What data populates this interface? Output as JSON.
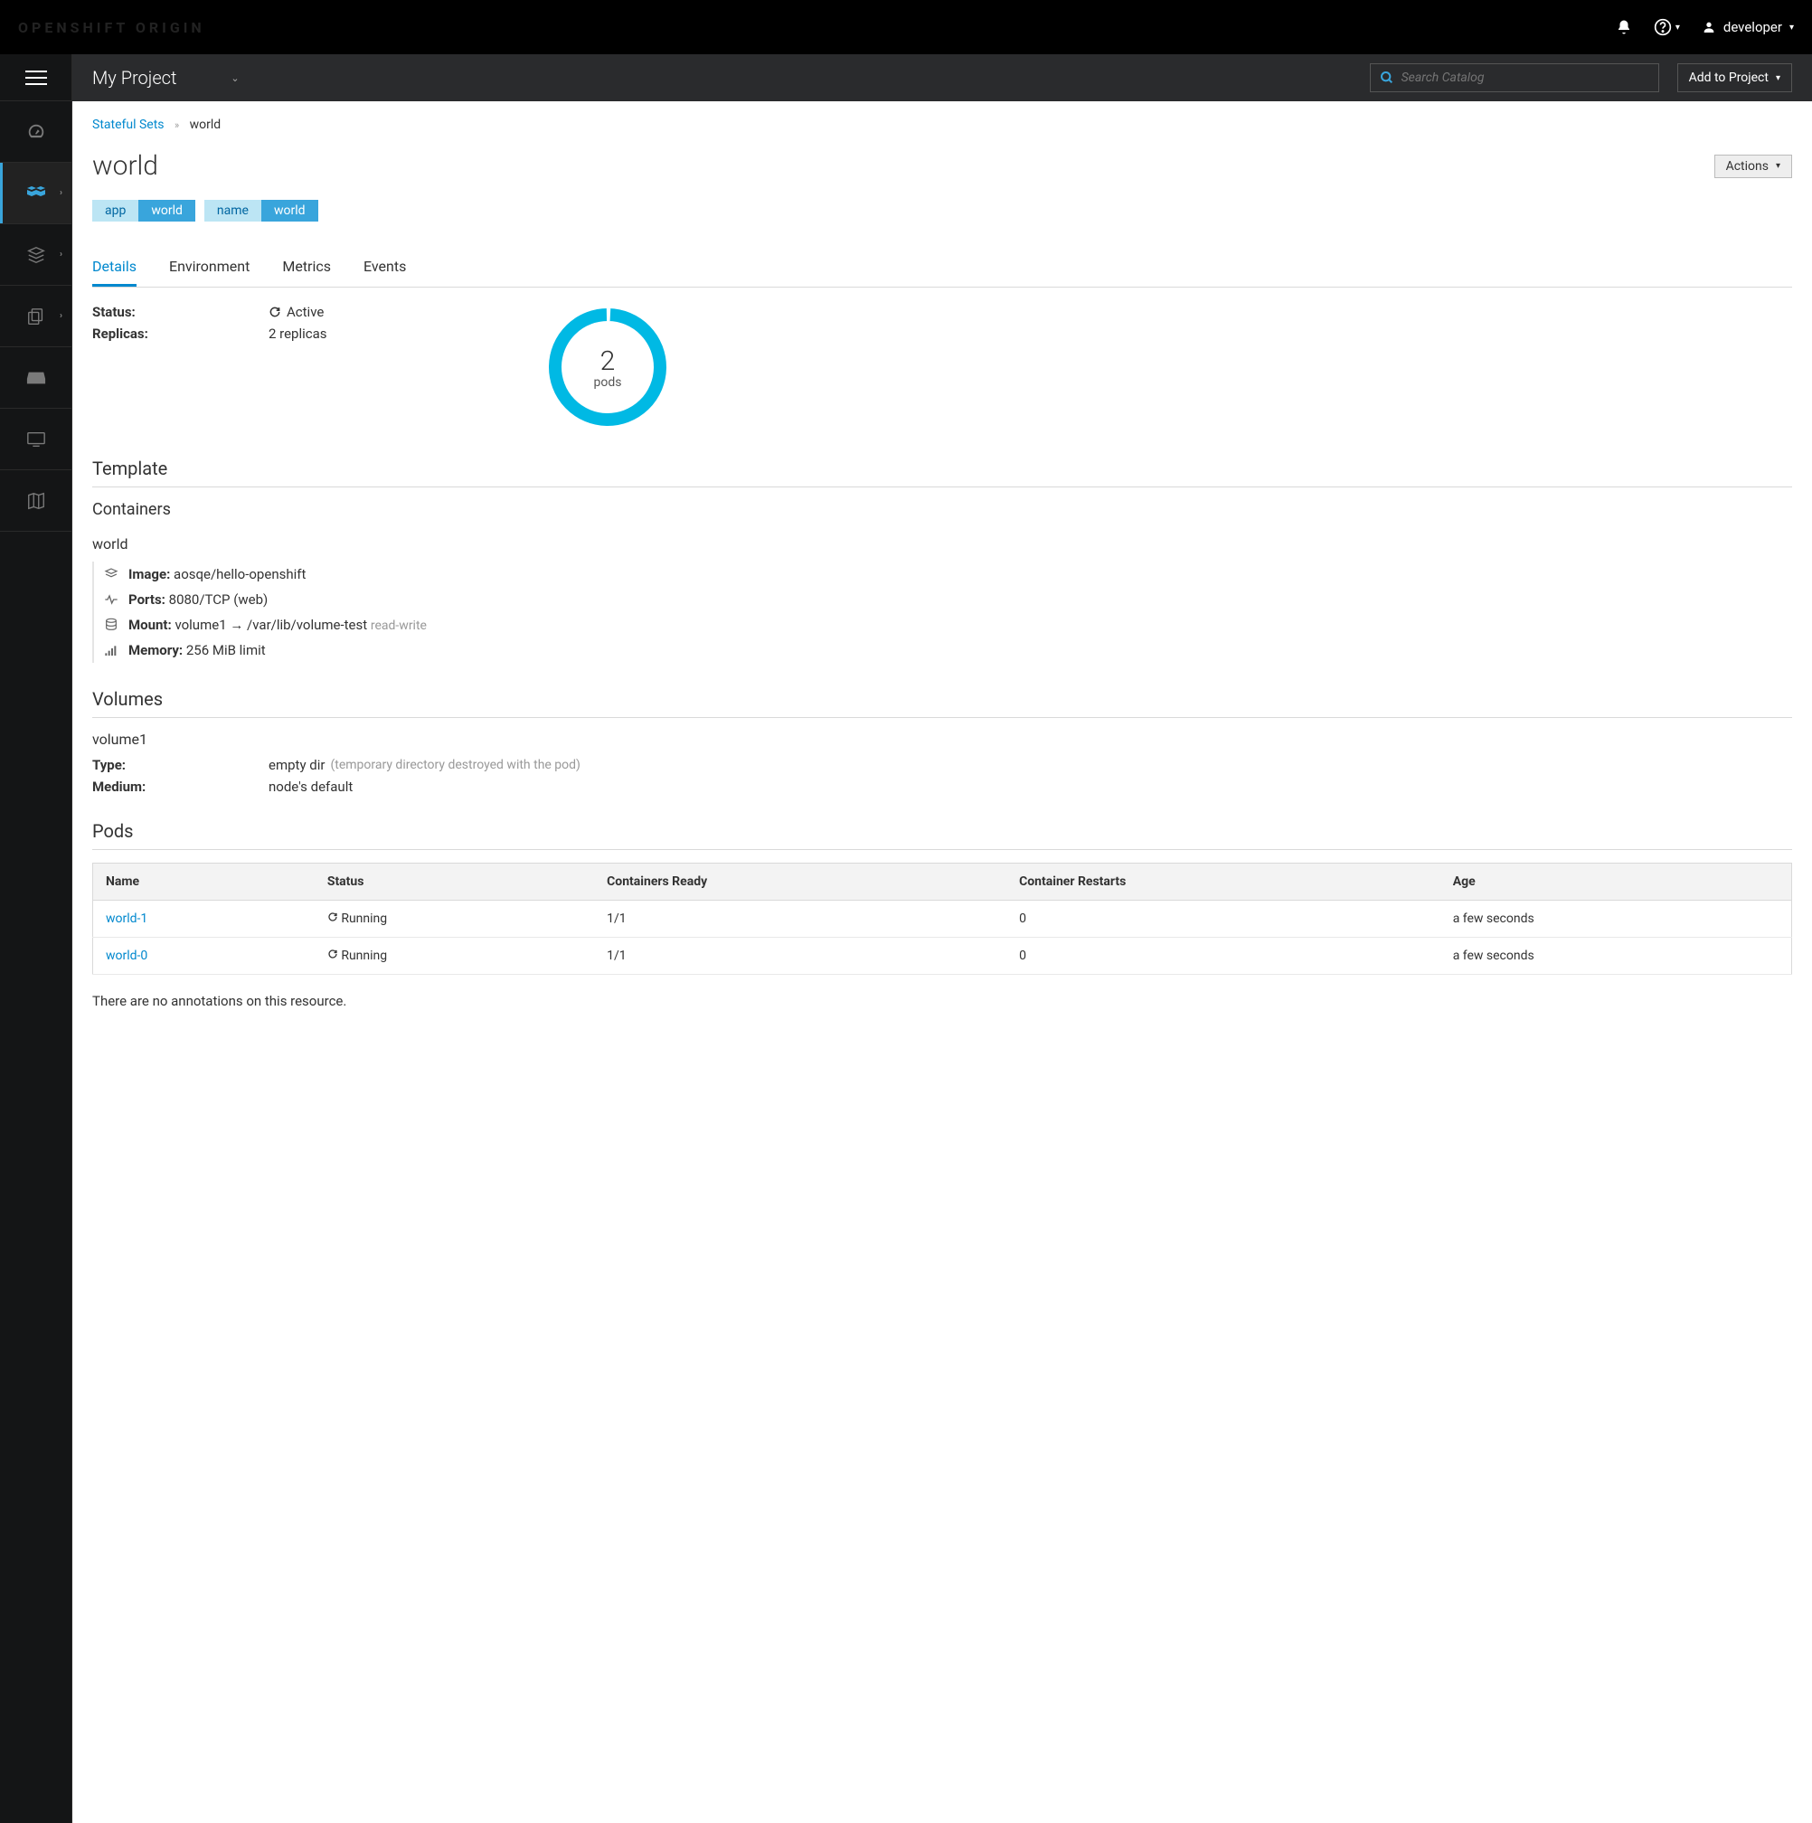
{
  "brand": "OPENSHIFT ORIGIN",
  "user": {
    "name": "developer"
  },
  "project": {
    "name": "My Project"
  },
  "search": {
    "placeholder": "Search Catalog"
  },
  "addToProject": "Add to Project",
  "breadcrumb": {
    "parent": "Stateful Sets",
    "current": "world"
  },
  "page": {
    "title": "world",
    "actions": "Actions"
  },
  "labels": [
    {
      "key": "app",
      "value": "world"
    },
    {
      "key": "name",
      "value": "world"
    }
  ],
  "tabs": [
    "Details",
    "Environment",
    "Metrics",
    "Events"
  ],
  "activeTab": "Details",
  "status": {
    "label": "Status:",
    "value": "Active"
  },
  "replicas": {
    "label": "Replicas:",
    "value": "2 replicas"
  },
  "pods_donut": {
    "count": "2",
    "label": "pods"
  },
  "template_h": "Template",
  "containers_h": "Containers",
  "container": {
    "name": "world",
    "image_label": "Image:",
    "image": "aosqe/hello-openshift",
    "ports_label": "Ports:",
    "ports": "8080/TCP (web)",
    "mount_label": "Mount:",
    "mount": "volume1 → /var/lib/volume-test",
    "mount_mode": "read-write",
    "memory_label": "Memory:",
    "memory": "256 MiB limit"
  },
  "volumes_h": "Volumes",
  "volume": {
    "name": "volume1",
    "type_label": "Type:",
    "type": "empty dir",
    "type_note": "(temporary directory destroyed with the pod)",
    "medium_label": "Medium:",
    "medium": "node's default"
  },
  "pods_h": "Pods",
  "pods_table": {
    "headers": [
      "Name",
      "Status",
      "Containers Ready",
      "Container Restarts",
      "Age"
    ],
    "rows": [
      {
        "name": "world-1",
        "status": "Running",
        "ready": "1/1",
        "restarts": "0",
        "age": "a few seconds"
      },
      {
        "name": "world-0",
        "status": "Running",
        "ready": "1/1",
        "restarts": "0",
        "age": "a few seconds"
      }
    ]
  },
  "annotations_msg": "There are no annotations on this resource."
}
